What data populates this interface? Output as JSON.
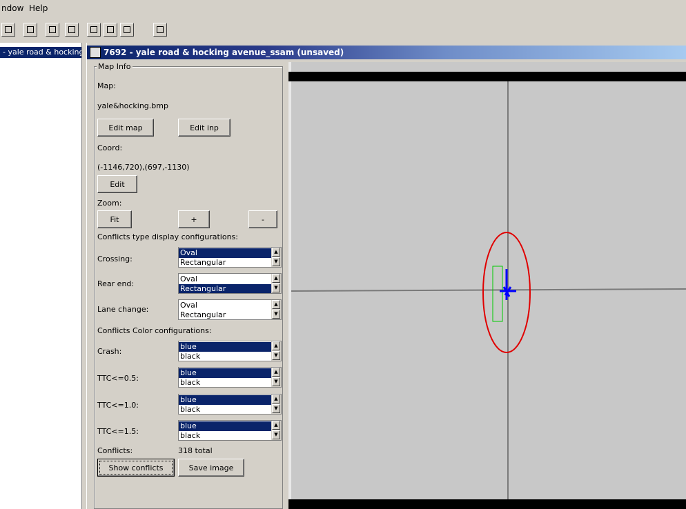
{
  "menu": {
    "items": [
      "ndow",
      "Help"
    ]
  },
  "toolbar": {
    "buttons": [
      "open-icon",
      "save-icon",
      "window-icon",
      "split-horizontal-icon",
      "split-vertical-icon",
      "grid-icon",
      "cascade-icon",
      "export-icon"
    ]
  },
  "tree": {
    "selected_item": "- yale road & hocking"
  },
  "window": {
    "title": "7692 - yale road & hocking avenue_ssam (unsaved)"
  },
  "map_info": {
    "group_title": "Map Info",
    "map_label": "Map:",
    "map_file": "yale&hocking.bmp",
    "edit_map": "Edit map",
    "edit_inp": "Edit inp",
    "coord_label": "Coord:",
    "coord_value": "(-1146,720),(697,-1130)",
    "edit": "Edit",
    "zoom_label": "Zoom:",
    "zoom_fit": "Fit",
    "zoom_in": "+",
    "zoom_out": "-",
    "conflict_type_heading": "Conflicts type display configurations:",
    "crossing_label": "Crossing:",
    "crossing_options": [
      "Oval",
      "Rectangular"
    ],
    "crossing_selected": "Oval",
    "rearend_label": "Rear end:",
    "rearend_options": [
      "Oval",
      "Rectangular"
    ],
    "rearend_selected": "Rectangular",
    "lanechange_label": "Lane change:",
    "lanechange_options": [
      "Oval",
      "Rectangular"
    ],
    "lanechange_selected": "",
    "color_heading": "Conflicts Color configurations:",
    "crash_label": "Crash:",
    "crash_options": [
      "blue",
      "black"
    ],
    "ttc05_label": "TTC<=0.5:",
    "ttc05_options": [
      "blue",
      "black"
    ],
    "ttc10_label": "TTC<=1.0:",
    "ttc10_options": [
      "blue",
      "black"
    ],
    "ttc15_label": "TTC<=1.5:",
    "ttc15_options": [
      "blue",
      "black"
    ],
    "conflicts_label": "Conflicts:",
    "conflicts_total": "318 total",
    "show_conflicts": "Show conflicts",
    "save_image": "Save image"
  },
  "colors": {
    "highlight": "#0a246a",
    "annotation": "#e00000",
    "conflict": "#0000ff",
    "zone": "#00cc00"
  }
}
